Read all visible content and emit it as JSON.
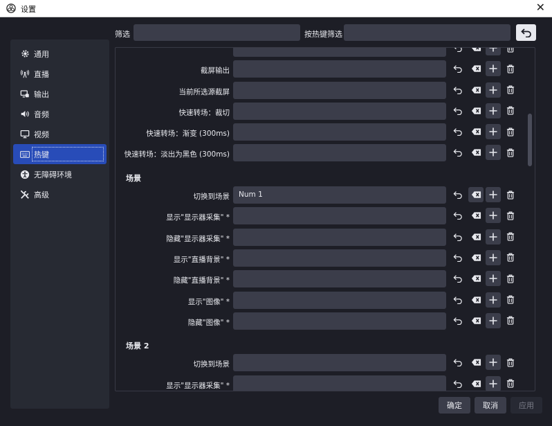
{
  "window": {
    "title": "设置",
    "close": "✕"
  },
  "sidebar": {
    "items": [
      {
        "label": "通用",
        "icon": "gear-icon"
      },
      {
        "label": "直播",
        "icon": "broadcast-icon"
      },
      {
        "label": "输出",
        "icon": "output-icon"
      },
      {
        "label": "音频",
        "icon": "speaker-icon"
      },
      {
        "label": "视频",
        "icon": "monitor-icon"
      },
      {
        "label": "热键",
        "icon": "keyboard-icon",
        "active": true
      },
      {
        "label": "无障碍环境",
        "icon": "accessibility-icon"
      },
      {
        "label": "高级",
        "icon": "tools-icon"
      }
    ]
  },
  "filter": {
    "label": "筛选",
    "value": "",
    "hotkey_label": "按热键筛选",
    "hotkey_value": ""
  },
  "hotkeys": {
    "rows_top": [
      {
        "label": "",
        "value": ""
      },
      {
        "label": "截屏输出",
        "value": ""
      },
      {
        "label": "当前所选源截屏",
        "value": ""
      },
      {
        "label": "快速转场：裁切",
        "value": ""
      },
      {
        "label": "快速转场：渐变 (300ms)",
        "value": ""
      },
      {
        "label": "快速转场：淡出为黑色 (300ms)",
        "value": ""
      }
    ],
    "section1": "场景",
    "rows_s1": [
      {
        "label": "切换到场景",
        "value": "Num 1",
        "filled": true
      },
      {
        "label": "显示\"显示器采集\" *",
        "value": ""
      },
      {
        "label": "隐藏\"显示器采集\" *",
        "value": ""
      },
      {
        "label": "显示\"直播背景\" *",
        "value": ""
      },
      {
        "label": "隐藏\"直播背景\" *",
        "value": ""
      },
      {
        "label": "显示\"图像\" *",
        "value": ""
      },
      {
        "label": "隐藏\"图像\" *",
        "value": ""
      }
    ],
    "section2": "场景 2",
    "rows_s2": [
      {
        "label": "切换到场景",
        "value": ""
      },
      {
        "label": "显示\"显示器采集\" *",
        "value": ""
      },
      {
        "label": "",
        "value": ""
      }
    ]
  },
  "footer": {
    "ok": "确定",
    "cancel": "取消",
    "apply": "应用"
  }
}
